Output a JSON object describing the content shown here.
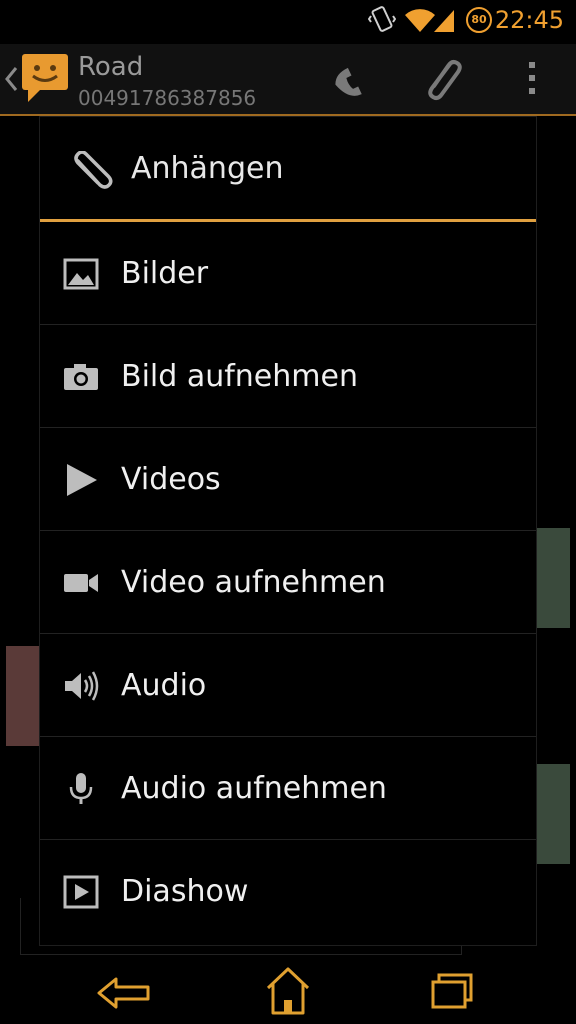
{
  "status_bar": {
    "battery_level": "80",
    "time": "22:45",
    "accent_color": "#f0a030"
  },
  "action_bar": {
    "contact_name": "Road",
    "contact_number": "00491786387856",
    "icons": [
      "back-arrow-icon",
      "messaging-avatar-icon",
      "phone-icon",
      "paperclip-icon",
      "overflow-menu-icon"
    ]
  },
  "dialog": {
    "title": "Anhängen",
    "title_icon": "paperclip-icon",
    "separator_color": "#e0a040",
    "items": [
      {
        "label": "Bilder",
        "icon": "picture-icon"
      },
      {
        "label": "Bild aufnehmen",
        "icon": "camera-icon"
      },
      {
        "label": "Videos",
        "icon": "play-icon"
      },
      {
        "label": "Video aufnehmen",
        "icon": "video-camera-icon"
      },
      {
        "label": "Audio",
        "icon": "speaker-icon"
      },
      {
        "label": "Audio aufnehmen",
        "icon": "microphone-icon"
      },
      {
        "label": "Diashow",
        "icon": "slideshow-icon"
      }
    ]
  },
  "nav_bar": {
    "buttons": [
      "back-nav-icon",
      "home-nav-icon",
      "recent-apps-icon"
    ],
    "color": "#e0a030"
  }
}
